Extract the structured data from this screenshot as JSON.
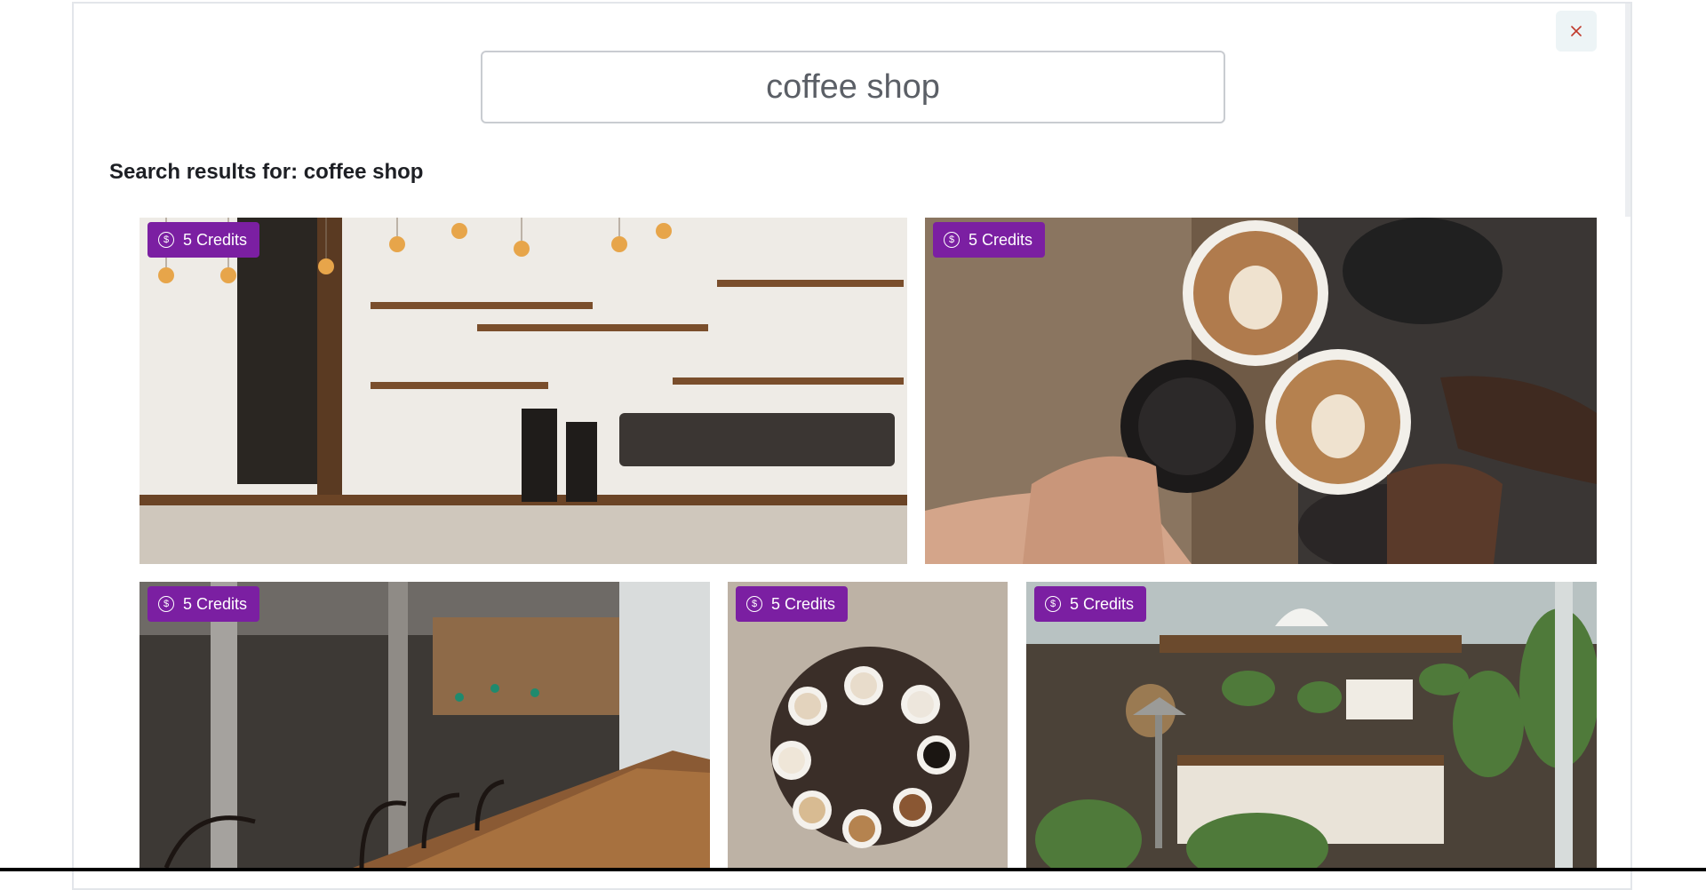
{
  "search": {
    "value": "coffee shop",
    "placeholder": "Search"
  },
  "results": {
    "heading": "Search results for: coffee shop"
  },
  "close": {
    "icon": "close-icon"
  },
  "colors": {
    "badge": "#7b1fa2",
    "close_icon": "#c0392b"
  },
  "images": [
    {
      "credits": "5 Credits",
      "subject": "coffee-shop-counter"
    },
    {
      "credits": "5 Credits",
      "subject": "coffee-cups-toast"
    },
    {
      "credits": "5 Credits",
      "subject": "cafe-interior"
    },
    {
      "credits": "5 Credits",
      "subject": "coffee-cups-table-topdown"
    },
    {
      "credits": "5 Credits",
      "subject": "greenhouse-cafe"
    }
  ]
}
